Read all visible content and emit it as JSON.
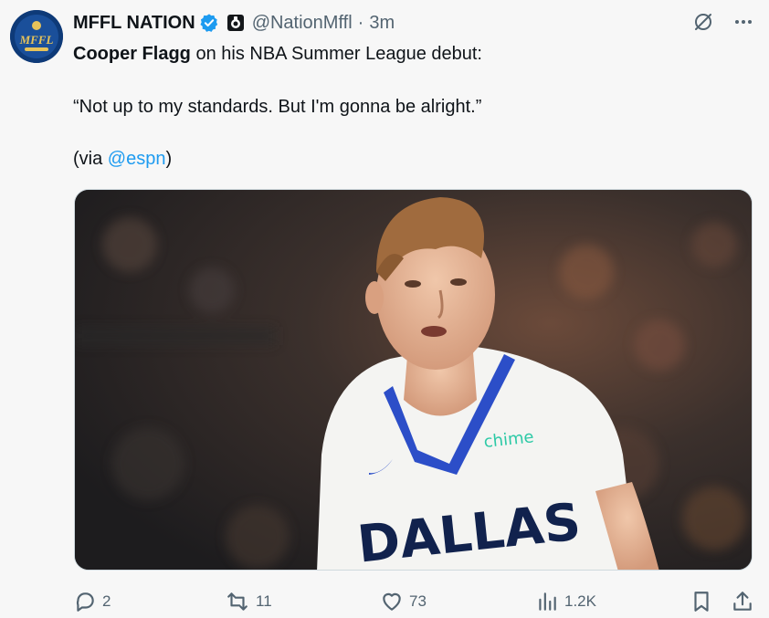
{
  "author": {
    "display_name": "MFFL NATION",
    "handle": "@NationMffl",
    "separator": "·",
    "time": "3m",
    "avatar_text": "MFFL"
  },
  "body": {
    "line1_bold": "Cooper Flagg",
    "line1_rest": " on his NBA Summer League debut:",
    "quote": "“Not up to my standards. But I'm gonna be alright.”",
    "via_open": "(via ",
    "via_mention": "@espn",
    "via_close": ")"
  },
  "media": {
    "jersey_text": "DALLAS",
    "sponsor_text": "chime"
  },
  "metrics": {
    "replies": "2",
    "reposts": "11",
    "likes": "73",
    "views": "1.2K"
  },
  "colors": {
    "accent": "#1d9bf0",
    "muted": "#536471",
    "text": "#0f1419",
    "verified": "#1d9bf0"
  },
  "icons": {
    "verified": "verified-badge-icon",
    "affiliate": "affiliate-badge-icon",
    "grok": "grok-icon",
    "more": "more-icon",
    "reply": "reply-icon",
    "repost": "repost-icon",
    "like": "like-icon",
    "views": "views-icon",
    "bookmark": "bookmark-icon",
    "share": "share-icon"
  }
}
